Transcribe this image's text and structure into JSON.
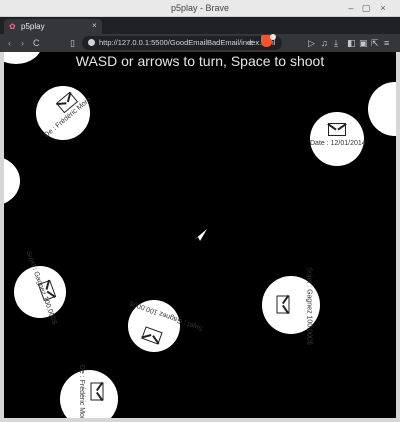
{
  "window": {
    "title": "p5play - Brave"
  },
  "window_controls": {
    "minimize": "–",
    "maximize": "▢",
    "close": "×"
  },
  "tab": {
    "title": "p5play",
    "close": "×",
    "new_tab": "+"
  },
  "toolbar": {
    "back": "‹",
    "forward": "›",
    "reload": "C",
    "bookmark": "▯",
    "url": "http://127.0.0.1:5500/GoodEmailBadEmail/index.html",
    "share": "<",
    "right_icons": [
      "▷",
      "♫",
      "⤓",
      "◧",
      "▣",
      "⇱",
      "≡"
    ]
  },
  "game": {
    "instructions": "WASD or arrows to turn, Space to shoot",
    "labels": {
      "de": "De : Frédéric Mora",
      "date": "Date : 12/01/2014",
      "sujet": "Sujet : Gagnez 100.000$",
      "envelope": "✉"
    }
  }
}
